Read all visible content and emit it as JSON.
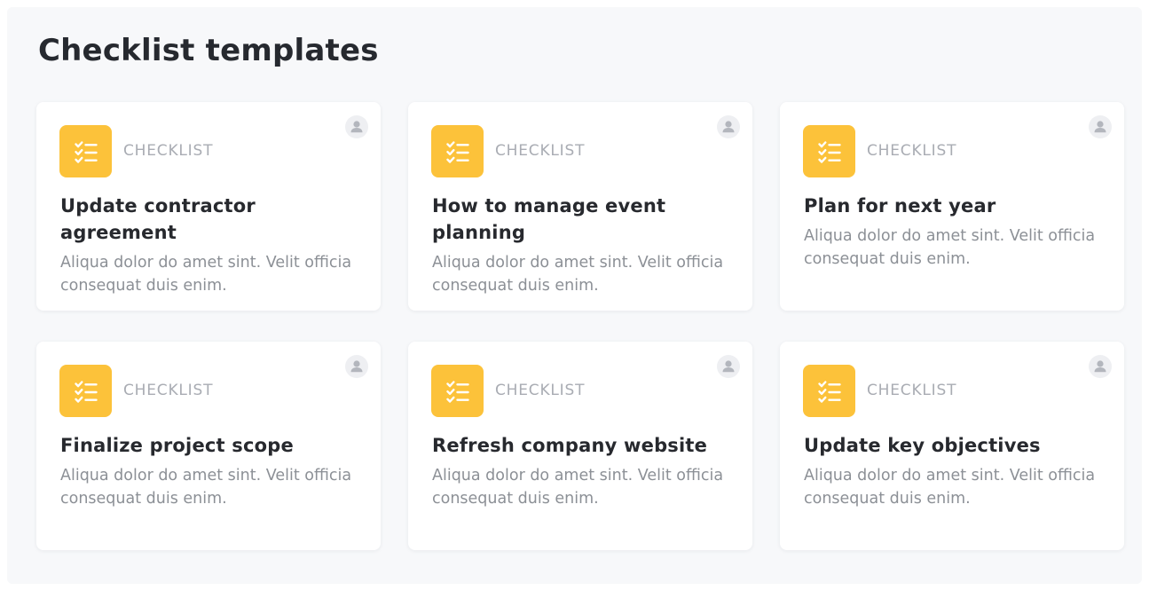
{
  "page": {
    "title": "Checklist templates"
  },
  "colors": {
    "accent": "#fcc23a",
    "background": "#f7f8fa"
  },
  "cards": [
    {
      "type_label": "CHECKLIST",
      "type_icon": "checklist-icon",
      "owner_icon": "user-icon",
      "title": "Update contractor agreement",
      "description": "Aliqua dolor do amet sint. Velit officia consequat duis enim."
    },
    {
      "type_label": "CHECKLIST",
      "type_icon": "checklist-icon",
      "owner_icon": "user-icon",
      "title": "How to manage event planning",
      "description": "Aliqua dolor do amet sint. Velit officia consequat duis enim."
    },
    {
      "type_label": "CHECKLIST",
      "type_icon": "checklist-icon",
      "owner_icon": "user-icon",
      "title": "Plan for next year",
      "description": "Aliqua dolor do amet sint. Velit officia consequat duis enim."
    },
    {
      "type_label": "CHECKLIST",
      "type_icon": "checklist-icon",
      "owner_icon": "user-icon",
      "title": "Finalize project scope",
      "description": "Aliqua dolor do amet sint. Velit officia consequat duis enim."
    },
    {
      "type_label": "CHECKLIST",
      "type_icon": "checklist-icon",
      "owner_icon": "user-icon",
      "title": "Refresh company website",
      "description": "Aliqua dolor do amet sint. Velit officia consequat duis enim."
    },
    {
      "type_label": "CHECKLIST",
      "type_icon": "checklist-icon",
      "owner_icon": "user-icon",
      "title": "Update key objectives",
      "description": "Aliqua dolor do amet sint. Velit officia consequat duis enim."
    }
  ]
}
